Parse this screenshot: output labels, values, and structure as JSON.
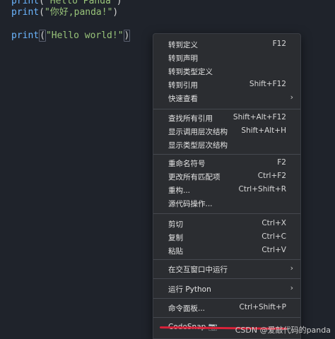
{
  "editor": {
    "line1": {
      "kw": "print",
      "open": "(",
      "str": "\"Hello Panda\"",
      "close": ")"
    },
    "line2": {
      "kw": "print",
      "open": "(",
      "str": "\"你好,panda!\"",
      "close": ")"
    },
    "line3": {
      "kw": "print",
      "open": "(",
      "str": "\"Hello world!\"",
      "close": ")"
    }
  },
  "context_menu": {
    "items": [
      {
        "label": "转到定义",
        "shortcut": "F12"
      },
      {
        "label": "转到声明",
        "shortcut": ""
      },
      {
        "label": "转到类型定义",
        "shortcut": ""
      },
      {
        "label": "转到引用",
        "shortcut": "Shift+F12"
      },
      {
        "label": "快速查看",
        "shortcut": "",
        "submenu": "›"
      },
      {
        "label": "查找所有引用",
        "shortcut": "Shift+Alt+F12"
      },
      {
        "label": "显示调用层次结构",
        "shortcut": "Shift+Alt+H"
      },
      {
        "label": "显示类型层次结构",
        "shortcut": ""
      },
      {
        "label": "重命名符号",
        "shortcut": "F2"
      },
      {
        "label": "更改所有匹配项",
        "shortcut": "Ctrl+F2"
      },
      {
        "label": "重构...",
        "shortcut": "Ctrl+Shift+R"
      },
      {
        "label": "源代码操作...",
        "shortcut": ""
      },
      {
        "label": "剪切",
        "shortcut": "Ctrl+X"
      },
      {
        "label": "复制",
        "shortcut": "Ctrl+C"
      },
      {
        "label": "粘贴",
        "shortcut": "Ctrl+V"
      },
      {
        "label": "在交互窗口中运行",
        "shortcut": "",
        "submenu": "›"
      },
      {
        "label": "运行 Python",
        "shortcut": "",
        "submenu": "›"
      },
      {
        "label": "命令面板...",
        "shortcut": "Ctrl+Shift+P"
      },
      {
        "label": "CodeSnap 📷",
        "shortcut": ""
      }
    ]
  },
  "watermark": "CSDN @爱敲代码的panda",
  "colors": {
    "background": "#1f232b",
    "menu_background": "#2b2d31",
    "keyword": "#6cb6ff",
    "string": "#98c379",
    "underline": "#d9233a"
  }
}
